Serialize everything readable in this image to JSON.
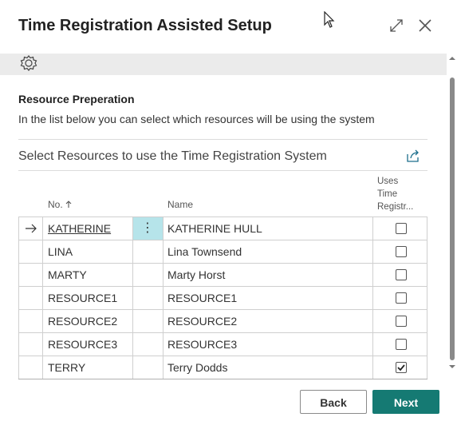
{
  "dialog": {
    "title": "Time Registration Assisted Setup"
  },
  "section": {
    "title": "Resource Preperation",
    "description": "In the list below you can select which resources will be using the system"
  },
  "part": {
    "title": "Select Resources to use the Time Registration System"
  },
  "columns": {
    "no": "No.",
    "name": "Name",
    "uses_line1": "Uses",
    "uses_line2": "Time",
    "uses_line3": "Registr..."
  },
  "rows": [
    {
      "no": "KATHERINE",
      "name": "KATHERINE HULL",
      "uses": false,
      "selected": true
    },
    {
      "no": "LINA",
      "name": "Lina Townsend",
      "uses": false
    },
    {
      "no": "MARTY",
      "name": "Marty Horst",
      "uses": false
    },
    {
      "no": "RESOURCE1",
      "name": "RESOURCE1",
      "uses": false
    },
    {
      "no": "RESOURCE2",
      "name": "RESOURCE2",
      "uses": false
    },
    {
      "no": "RESOURCE3",
      "name": "RESOURCE3",
      "uses": false
    },
    {
      "no": "TERRY",
      "name": "Terry Dodds",
      "uses": true
    }
  ],
  "buttons": {
    "back": "Back",
    "next": "Next"
  },
  "icons": {
    "expand": "expand-icon",
    "close": "close-icon",
    "settings": "gear-icon",
    "share": "share-icon",
    "sort": "sort-ascending-icon",
    "row_indicator": "arrow-right-icon",
    "row_actions": "more-options-icon"
  },
  "colors": {
    "accent": "#157a73",
    "selected_cell": "#b6e4ea",
    "toolbar": "#ebebeb"
  }
}
